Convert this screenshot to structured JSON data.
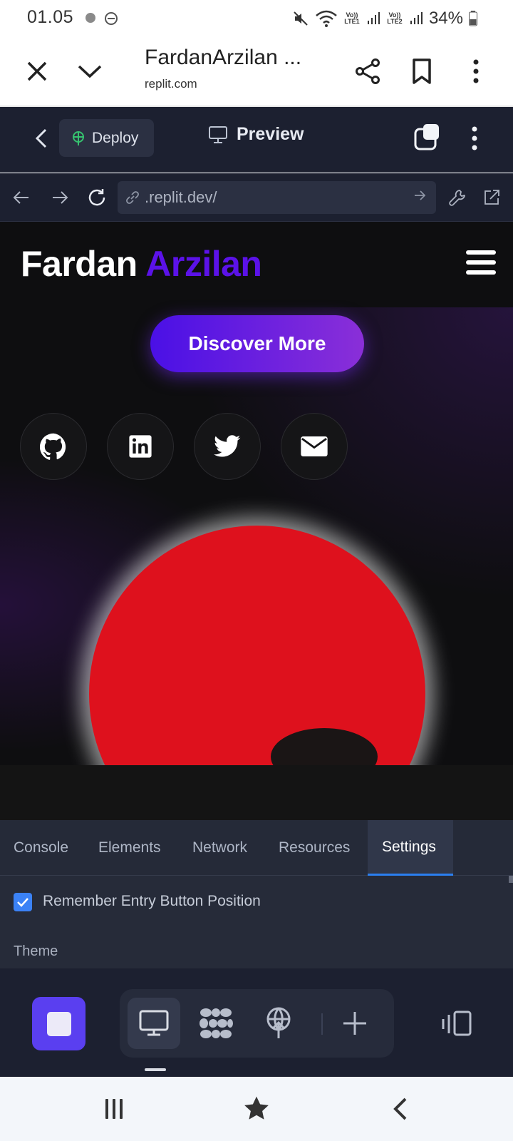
{
  "status_bar": {
    "time": "01.05",
    "sim1": "Vo)) LTE1",
    "sim2": "Vo)) LTE2",
    "battery": "34%"
  },
  "browser": {
    "title": "FardanArzilan ...",
    "url": "replit.com"
  },
  "replit_header": {
    "deploy_label": "Deploy",
    "preview_label": "Preview"
  },
  "replit_nav": {
    "address": ".replit.dev/"
  },
  "site": {
    "logo_first": "Fardan",
    "logo_second": "Arzilan",
    "cta_label": "Discover More",
    "social_icons": [
      "github-icon",
      "linkedin-icon",
      "twitter-icon",
      "mail-icon"
    ]
  },
  "devtools": {
    "tabs": [
      "Console",
      "Elements",
      "Network",
      "Resources",
      "Settings"
    ],
    "active_tab": "Settings",
    "checkbox_label": "Remember Entry Button Position",
    "checkbox_checked": true,
    "section_label": "Theme"
  },
  "colors": {
    "accent_purple": "#5b12e8",
    "avatar_red": "#de111d",
    "replit_bg": "#1c2030",
    "stop_button": "#5a3ff0"
  }
}
